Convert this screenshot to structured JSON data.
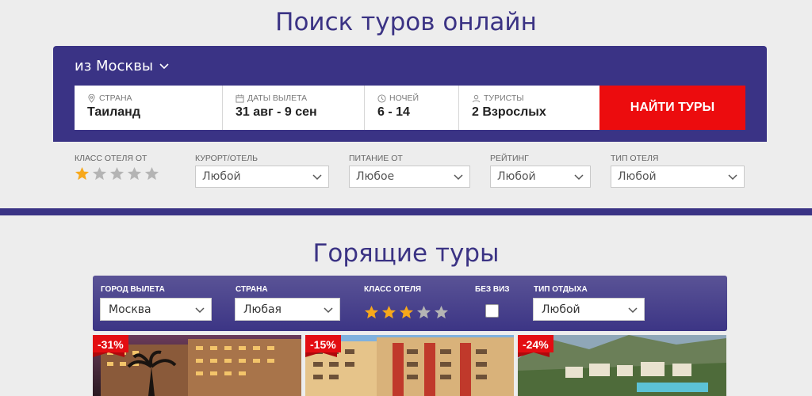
{
  "search": {
    "title": "Поиск туров онлайн",
    "from_city": "из Москвы",
    "fields": [
      {
        "label": "СТРАНА",
        "value": "Таиланд",
        "icon": "map-pin-icon"
      },
      {
        "label": "ДАТЫ ВЫЛЕТА",
        "value": "31 авг - 9 сен",
        "icon": "calendar-icon"
      },
      {
        "label": "НОЧЕЙ",
        "value": "6 - 14",
        "icon": "clock-icon"
      },
      {
        "label": "ТУРИСТЫ",
        "value": "2 Взрослых",
        "icon": "person-icon"
      }
    ],
    "find_button": "НАЙТИ ТУРЫ",
    "filters": {
      "hotel_class": {
        "label": "КЛАСС ОТЕЛЯ ОТ",
        "rating": 1,
        "max": 5
      },
      "resort": {
        "label": "КУРОРТ/ОТЕЛЬ",
        "value": "Любой"
      },
      "meal": {
        "label": "ПИТАНИЕ ОТ",
        "value": "Любое"
      },
      "rating": {
        "label": "РЕЙТИНГ",
        "value": "Любой"
      },
      "hotel_type": {
        "label": "ТИП ОТЕЛЯ",
        "value": "Любой"
      }
    }
  },
  "hot": {
    "title": "Горящие туры",
    "departure": {
      "label": "ГОРОД ВЫЛЕТА",
      "value": "Москва"
    },
    "country": {
      "label": "СТРАНА",
      "value": "Любая"
    },
    "hotel_class": {
      "label": "КЛАСС ОТЕЛЯ",
      "rating": 3,
      "max": 5
    },
    "no_visa": {
      "label": "БЕЗ ВИЗ",
      "checked": false
    },
    "rest_type": {
      "label": "ТИП ОТДЫХА",
      "value": "Любой"
    },
    "cards": [
      {
        "discount": "-31%"
      },
      {
        "discount": "-15%"
      },
      {
        "discount": "-24%"
      }
    ]
  },
  "colors": {
    "brand": "#3a3385",
    "accent": "#ec0c0e",
    "star_active": "#f7a81b",
    "star_inactive": "#b4b4b4"
  }
}
